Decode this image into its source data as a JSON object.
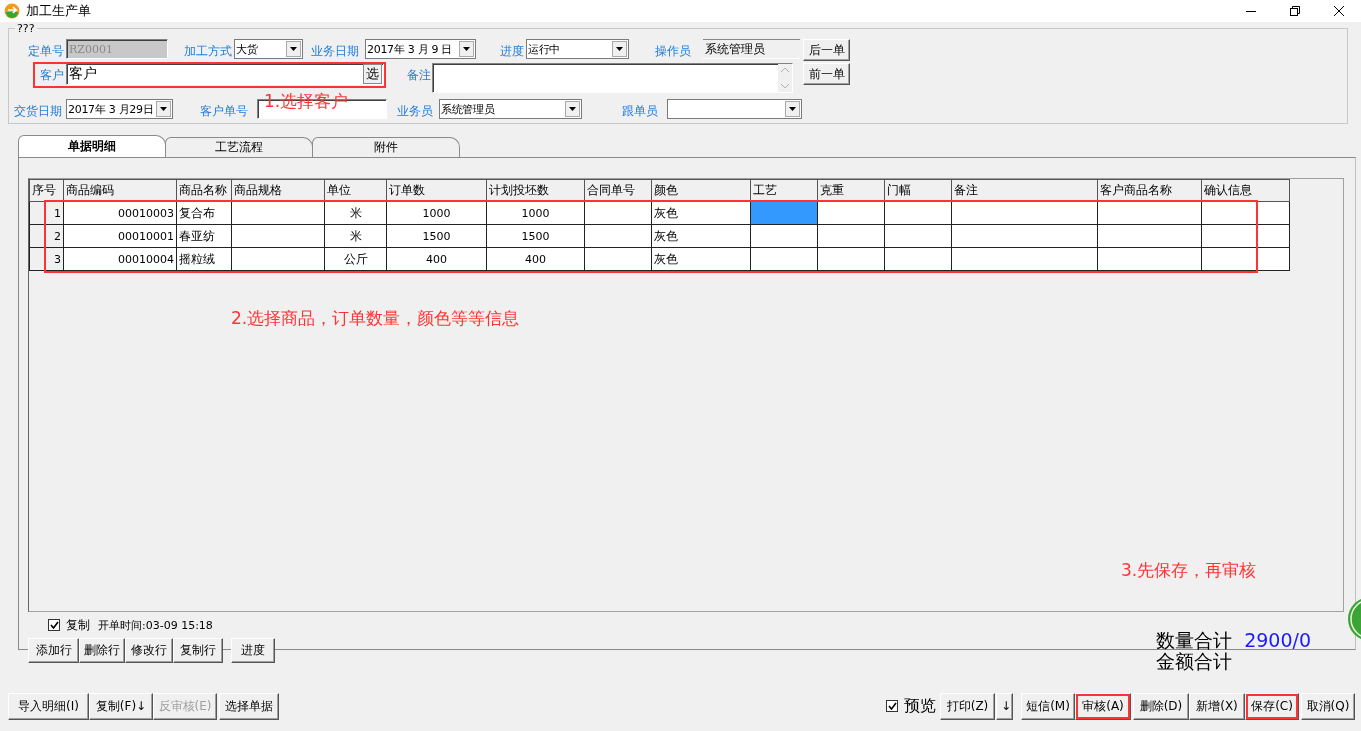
{
  "window": {
    "title": "加工生产单"
  },
  "header": {
    "group_title": "???",
    "rows": [
      {
        "fields": [
          {
            "label": "定单号",
            "kind": "text",
            "value": "RZ0001",
            "disabled": true
          },
          {
            "label": "加工方式",
            "kind": "select",
            "value": "大货",
            "disabled": false
          },
          {
            "label": "业务日期",
            "kind": "select",
            "value": "2017年 3 月 9 日",
            "disabled": false
          },
          {
            "label": "进度",
            "kind": "select",
            "value": "运行中",
            "disabled": false
          },
          {
            "label": "操作员",
            "kind": "readonly",
            "value": "系统管理员",
            "disabled": false
          }
        ],
        "button": "后一单"
      },
      {
        "fields": [
          {
            "label": "客户",
            "kind": "lookup",
            "value": "客户",
            "button": "选",
            "disabled": false
          },
          {
            "label": "备注",
            "kind": "memo",
            "disabled": false
          }
        ],
        "button": "前一单"
      },
      {
        "fields": [
          {
            "label": "交货日期",
            "kind": "select",
            "value": "2017年 3 月29日",
            "disabled": false
          },
          {
            "label": "客户单号",
            "kind": "text",
            "disabled": false
          },
          {
            "label": "业务员",
            "kind": "select",
            "value": "系统管理员",
            "disabled": false
          },
          {
            "label": "跟单员",
            "kind": "select",
            "disabled": false
          }
        ]
      }
    ]
  },
  "tabs": [
    {
      "label": "单据明细",
      "selected": true
    },
    {
      "label": "工艺流程",
      "selected": false
    },
    {
      "label": "附件",
      "selected": false
    }
  ],
  "table": {
    "columns": [
      "序号",
      "商品编码",
      "商品名称",
      "商品规格",
      "单位",
      "订单数",
      "计划投坯数",
      "合同单号",
      "颜色",
      "工艺",
      "克重",
      "门幅",
      "备注",
      "客户商品名称",
      "确认信息"
    ],
    "rows": [
      {
        "cells": [
          "1",
          "00010003",
          "复合布",
          "",
          "米",
          "1000",
          "1000",
          "",
          "灰色",
          "",
          "",
          "",
          "",
          "",
          ""
        ],
        "process_selected": true
      },
      {
        "cells": [
          "2",
          "00010001",
          "春亚纺",
          "",
          "米",
          "1500",
          "1500",
          "",
          "灰色",
          "",
          "",
          "",
          "",
          "",
          ""
        ],
        "process_selected": false
      },
      {
        "cells": [
          "3",
          "00010004",
          "摇粒绒",
          "",
          "公斤",
          "400",
          "400",
          "",
          "灰色",
          "",
          "",
          "",
          "",
          "",
          ""
        ],
        "process_selected": false
      }
    ]
  },
  "copy_option": {
    "label": "复制",
    "checked": true
  },
  "open_time": "开单时间:03-09 15:18",
  "row_buttons": [
    "添加行",
    "删除行",
    "修改行",
    "复制行",
    "进度"
  ],
  "totals": [
    {
      "label": "数量合计",
      "value": "2900/0"
    },
    {
      "label": "金额合计"
    }
  ],
  "left_buttons": [
    {
      "label": "导入明细(I)",
      "disabled": false
    },
    {
      "label": "复制(F)↓",
      "disabled": false
    },
    {
      "label": "反审核(E)",
      "disabled": true
    },
    {
      "label": "选择单据",
      "disabled": false
    }
  ],
  "preview_option": {
    "label": "预览",
    "checked": true
  },
  "right_buttons": [
    {
      "label": "打印(Z)",
      "highlighted": false
    },
    {
      "label": "↓",
      "highlighted": false
    },
    {
      "label": "短信(M)",
      "highlighted": false
    },
    {
      "label": "审核(A)",
      "highlighted": true
    },
    {
      "label": "删除(D)",
      "highlighted": false
    },
    {
      "label": "新增(X)",
      "highlighted": false
    },
    {
      "label": "保存(C)",
      "highlighted": true
    },
    {
      "label": "取消(Q)",
      "highlighted": false
    }
  ],
  "annotations": [
    {
      "text": "1.选择客户"
    },
    {
      "text": "2.选择商品，订单数量，颜色等等信息"
    },
    {
      "text": "3.先保存，再审核"
    }
  ]
}
